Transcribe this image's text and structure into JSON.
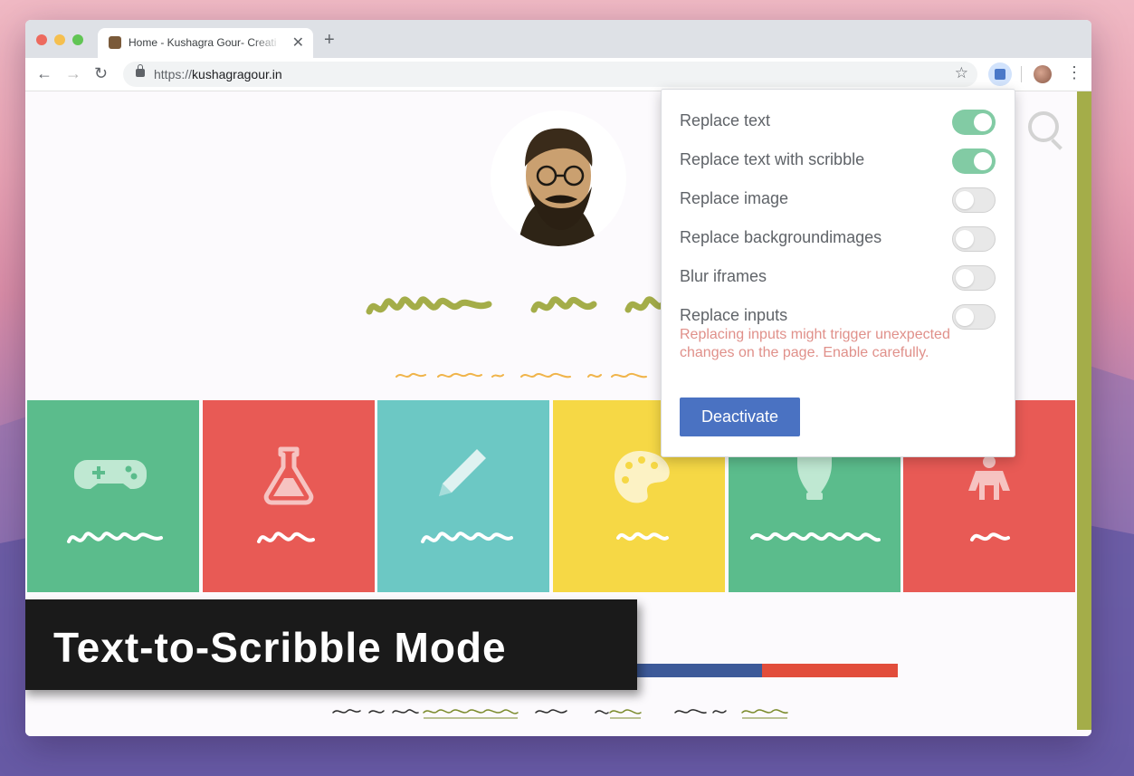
{
  "browser": {
    "tab_title": "Home - Kushagra Gour- Creati",
    "url_protocol": "https://",
    "url_domain": "kushagragour.in"
  },
  "popup": {
    "options": [
      {
        "label": "Replace text",
        "enabled": true
      },
      {
        "label": "Replace text with scribble",
        "enabled": true
      },
      {
        "label": "Replace image",
        "enabled": false
      },
      {
        "label": "Replace backgroundimages",
        "enabled": false
      },
      {
        "label": "Blur iframes",
        "enabled": false
      },
      {
        "label": "Replace inputs",
        "enabled": false
      }
    ],
    "warning": "Replacing inputs might trigger unexpected changes on the page. Enable carefully.",
    "deactivate_label": "Deactivate"
  },
  "banner": {
    "title": "Text-to-Scribble Mode"
  },
  "colors": {
    "tile_green": "#5bbc8c",
    "tile_red": "#e85a55",
    "tile_teal": "#6cc8c4",
    "tile_yellow": "#f6d845",
    "scribble_olive": "#a4ad49",
    "scribble_orange": "#f0b44a",
    "toggle_on": "#82cba4",
    "button_blue": "#4a72c2"
  },
  "tiles": [
    {
      "icon": "gamepad-icon",
      "color": "#5bbc8c"
    },
    {
      "icon": "flask-icon",
      "color": "#e85a55"
    },
    {
      "icon": "pencil-icon",
      "color": "#6cc8c4"
    },
    {
      "icon": "palette-icon",
      "color": "#f6d845"
    },
    {
      "icon": "hot-air-balloon-icon",
      "color": "#5bbc8c"
    },
    {
      "icon": "person-icon",
      "color": "#e85a55"
    }
  ]
}
